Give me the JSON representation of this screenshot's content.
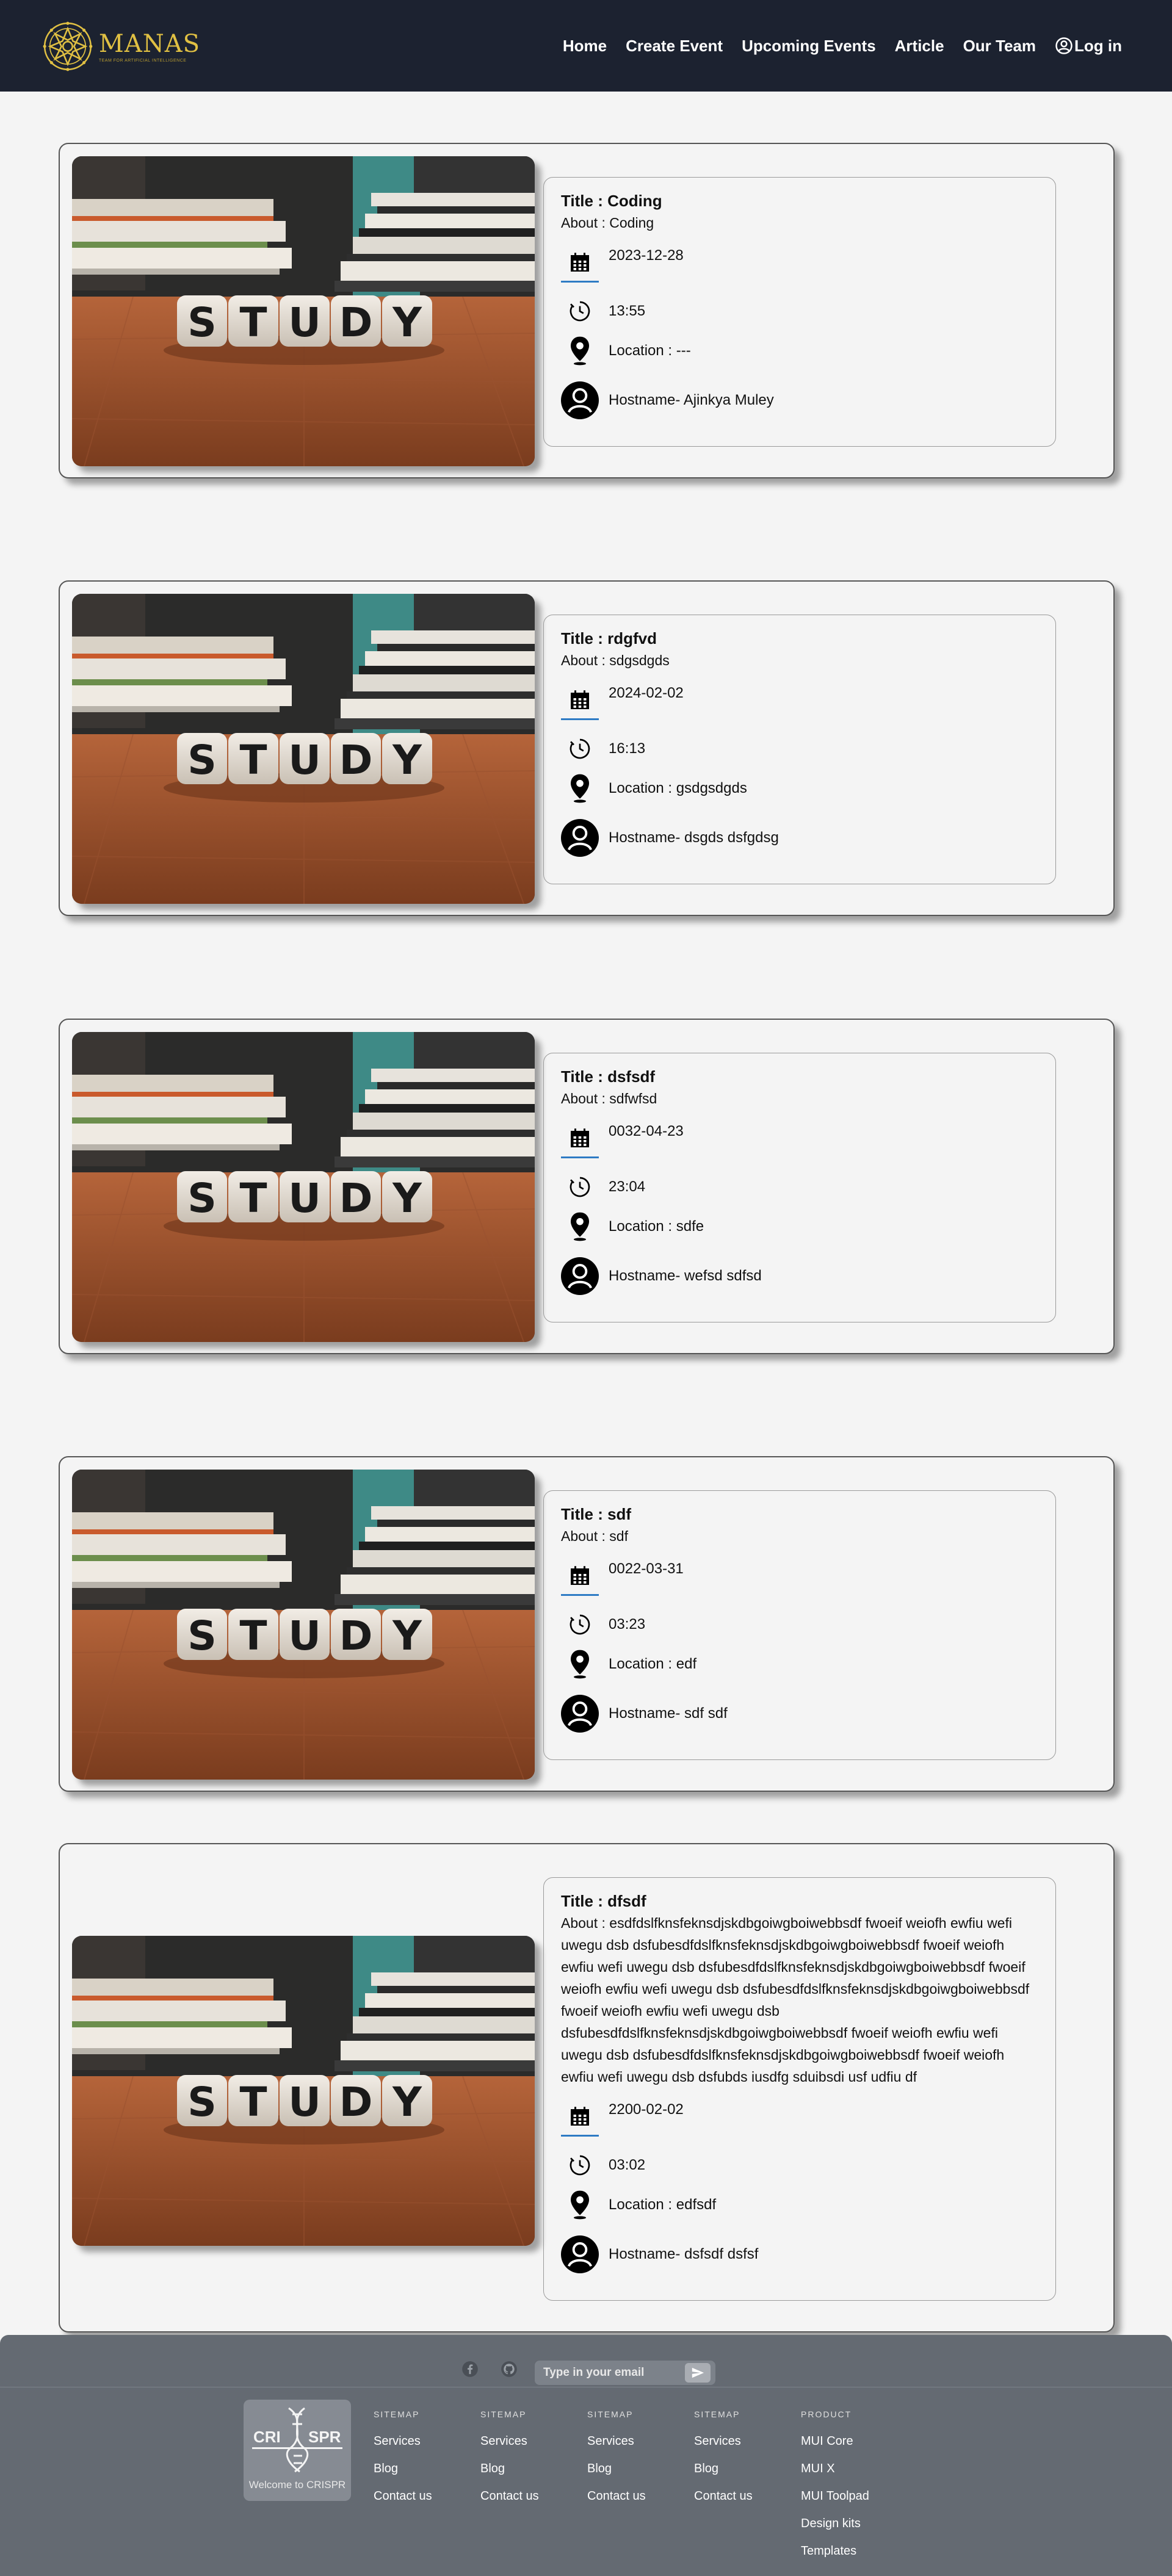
{
  "navbar": {
    "logo_text": "MANAS",
    "logo_subtitle": "TEAM FOR ARTIFICIAL INTELLIGENCE",
    "links": [
      "Home",
      "Create Event",
      "Upcoming Events",
      "Article",
      "Our Team"
    ],
    "login_label": "Log in"
  },
  "events": [
    {
      "image_word": "STUDY",
      "title": "Title : Coding",
      "about": "About : Coding",
      "date": "2023-12-28",
      "time": "13:55",
      "location": "Location : ---",
      "host": "Hostname- Ajinkya Muley"
    },
    {
      "image_word": "STUDY",
      "title": "Title : rdgfvd",
      "about": "About : sdgsdgds",
      "date": "2024-02-02",
      "time": "16:13",
      "location": "Location : gsdgsdgds",
      "host": "Hostname- dsgds dsfgdsg"
    },
    {
      "image_word": "STUDY",
      "title": "Title : dsfsdf",
      "about": "About : sdfwfsd",
      "date": "0032-04-23",
      "time": "23:04",
      "location": "Location : sdfe",
      "host": "Hostname- wefsd sdfsd"
    },
    {
      "image_word": "STUDY",
      "title": "Title : sdf",
      "about": "About : sdf",
      "date": "0022-03-31",
      "time": "03:23",
      "location": "Location : edf",
      "host": "Hostname- sdf sdf"
    },
    {
      "image_word": "STUDY",
      "title": "Title : dfsdf",
      "about": "About : esdfdslfknsfeknsdjskdbgoiwgboiwebbsdf fwoeif weiofh ewfiu wefi uwegu dsb dsfubesdfdslfknsfeknsdjskdbgoiwgboiwebbsdf fwoeif weiofh ewfiu wefi uwegu dsb dsfubesdfdslfknsfeknsdjskdbgoiwgboiwebbsdf fwoeif weiofh ewfiu wefi uwegu dsb dsfubesdfdslfknsfeknsdjskdbgoiwgboiwebbsdf fwoeif weiofh ewfiu wefi uwegu dsb dsfubesdfdslfknsfeknsdjskdbgoiwgboiwebbsdf fwoeif weiofh ewfiu wefi uwegu dsb dsfubesdfdslfknsfeknsdjskdbgoiwgboiwebbsdf fwoeif weiofh ewfiu wefi uwegu dsb dsfubds iusdfg sduibsdi usf udfiu df",
      "date": "2200-02-02",
      "time": "03:02",
      "location": "Location : edfsdf",
      "host": "Hostname- dsfsdf dsfsf"
    }
  ],
  "footer": {
    "subscribe_placeholder": "Type in your email",
    "crispr_logo_left": "CRI",
    "crispr_logo_right": "SPR",
    "crispr_welcome": "Welcome to CRISPR",
    "columns": [
      {
        "title": "SITEMAP",
        "items": [
          "Services",
          "Blog",
          "Contact us"
        ]
      },
      {
        "title": "SITEMAP",
        "items": [
          "Services",
          "Blog",
          "Contact us"
        ]
      },
      {
        "title": "SITEMAP",
        "items": [
          "Services",
          "Blog",
          "Contact us"
        ]
      },
      {
        "title": "SITEMAP",
        "items": [
          "Services",
          "Blog",
          "Contact us"
        ]
      },
      {
        "title": "PRODUCT",
        "items": [
          "MUI Core",
          "MUI X",
          "MUI Toolpad",
          "Design kits",
          "Templates"
        ]
      }
    ]
  },
  "colors": {
    "navbar_bg": "#1c2230",
    "page_bg": "#f4f4f4",
    "footer_bg": "#646a72",
    "accent_underline": "#2e7bc4",
    "logo_gold": "#e0c043"
  },
  "icons": {
    "date": "calendar-icon",
    "time": "clock-icon",
    "location": "location-pin-icon",
    "host": "user-avatar-icon",
    "login": "account-circle-icon",
    "send": "send-icon",
    "social": [
      "facebook-icon",
      "github-icon"
    ]
  }
}
